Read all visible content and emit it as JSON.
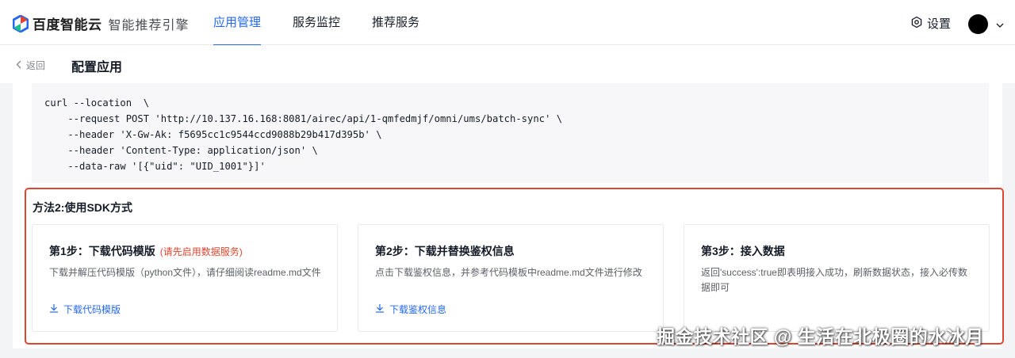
{
  "brand": {
    "logo_text": "百度智能云",
    "product_name": "智能推荐引擎"
  },
  "nav": {
    "items": [
      {
        "label": "应用管理",
        "active": true
      },
      {
        "label": "服务监控",
        "active": false
      },
      {
        "label": "推荐服务",
        "active": false
      }
    ]
  },
  "header": {
    "settings_label": "设置"
  },
  "subheader": {
    "back_label": "返回",
    "title": "配置应用"
  },
  "code": {
    "lines": [
      "curl --location  \\",
      "    --request POST 'http://10.137.16.168:8081/airec/api/1-qmfedmjf/omni/ums/batch-sync' \\",
      "    --header 'X-Gw-Ak: f5695cc1c9544ccd9088b29b417d395b' \\",
      "    --header 'Content-Type: application/json' \\",
      "    --data-raw '[{\"uid\": \"UID_1001\"}]'"
    ]
  },
  "method2": {
    "title": "方法2:使用SDK方式",
    "steps": [
      {
        "title": "第1步：下载代码模版",
        "warning": "(请先启用数据服务)",
        "desc": "下载并解压代码模版（python文件），请仔细阅读readme.md文件",
        "link": "下载代码模版"
      },
      {
        "title": "第2步：下载并替换鉴权信息",
        "desc": "点击下载鉴权信息，并参考代码模板中readme.md文件进行修改",
        "link": "下载鉴权信息"
      },
      {
        "title": "第3步：接入数据",
        "desc": "返回'success':true即表明接入成功，刷新数据状态，接入必传数据即可"
      }
    ]
  },
  "watermark": "掘金技术社区 @ 生活在北极圈的水冰月",
  "colors": {
    "accent": "#2468f2",
    "highlight_border": "#e0462f",
    "warning_text": "#e0462f"
  }
}
